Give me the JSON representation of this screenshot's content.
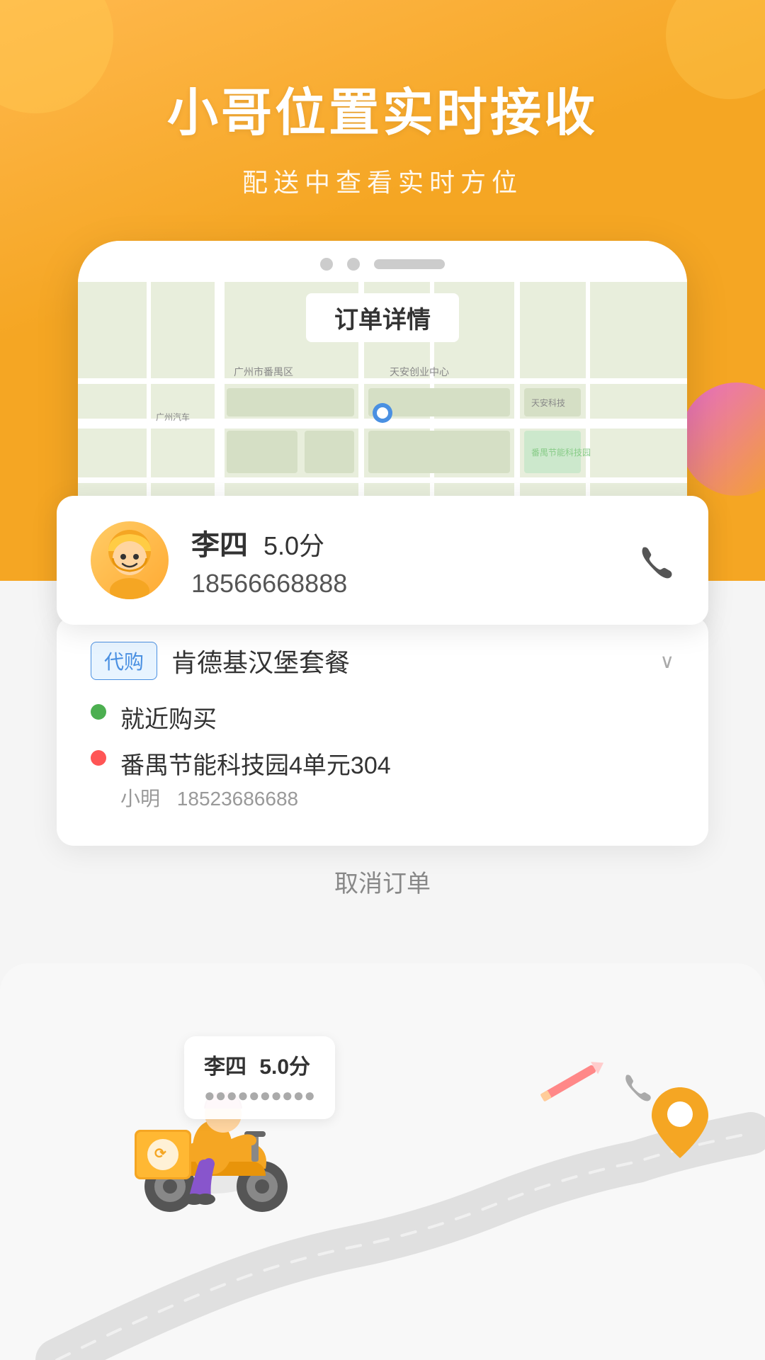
{
  "hero": {
    "title": "小哥位置实时接收",
    "subtitle": "配送中查看实时方位"
  },
  "phone": {
    "order_title": "订单详情"
  },
  "deliverer": {
    "name": "李四",
    "score": "5.0分",
    "phone": "18566668888"
  },
  "order": {
    "tag": "代购",
    "name": "肯德基汉堡套餐",
    "pickup_label": "就近购买",
    "delivery_address": "番禺节能科技园4单元304",
    "contact_name": "小明",
    "contact_phone": "18523686688"
  },
  "cancel": {
    "label": "取消订单"
  },
  "bottom_rider": {
    "name": "李四",
    "score": "5.0分"
  },
  "colors": {
    "orange": "#f5a623",
    "blue_tag": "#4a90e2",
    "green_dot": "#4caf50",
    "red_dot": "#ff5555"
  }
}
